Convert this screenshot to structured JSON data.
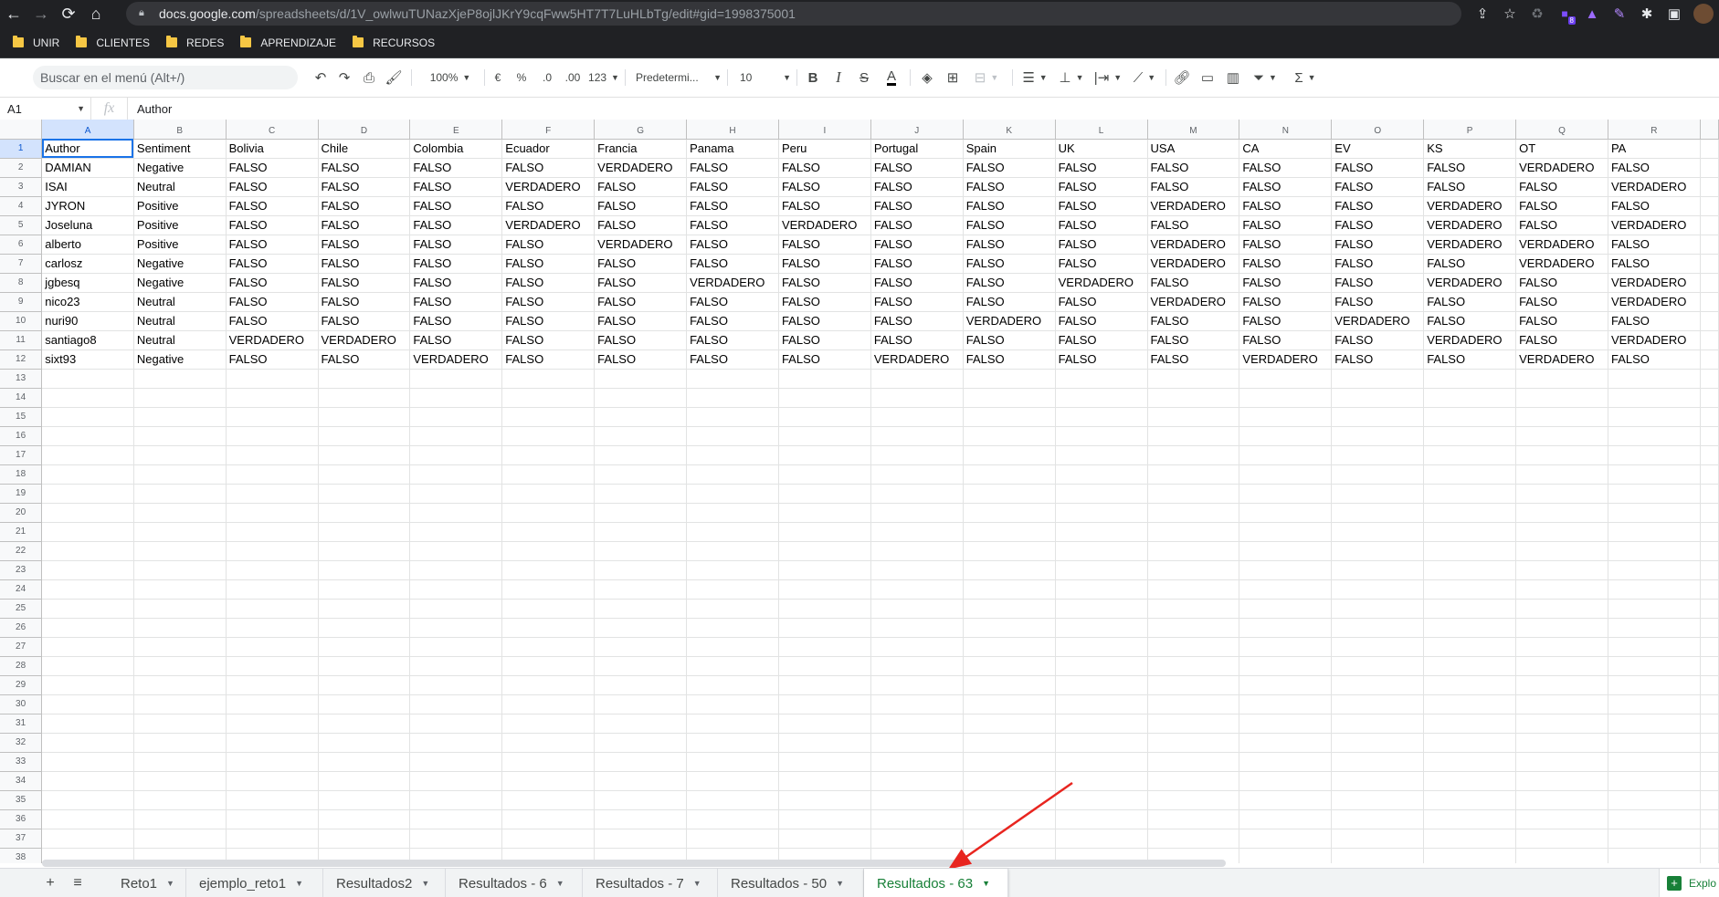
{
  "browser": {
    "url_host": "docs.google.com",
    "url_path": "/spreadsheets/d/1V_owlwuTUNazXjeP8ojlJKrY9cqFww5HT7T7LuHLbTg/edit#gid=1998375001",
    "bookmarks": [
      "UNIR",
      "CLIENTES",
      "REDES",
      "APRENDIZAJE",
      "RECURSOS"
    ],
    "extension_badge": "8"
  },
  "toolbar": {
    "menu_search_placeholder": "Buscar en el menú (Alt+/)",
    "zoom": "100%",
    "currency": "€",
    "percent": "%",
    "decimal_decrease": ".0",
    "decimal_increase": ".00",
    "more_formats": "123",
    "font_family": "Predetermi...",
    "font_size": "10",
    "bold": "B",
    "italic": "I",
    "strike": "S",
    "text_color": "A",
    "functions": "Σ"
  },
  "formula_bar": {
    "name_box": "A1",
    "fx": "fx",
    "content": "Author"
  },
  "grid": {
    "columns": [
      "A",
      "B",
      "C",
      "D",
      "E",
      "F",
      "G",
      "H",
      "I",
      "J",
      "K",
      "L",
      "M",
      "N",
      "O",
      "P",
      "Q",
      "R"
    ],
    "row_numbers": [
      "1",
      "2",
      "3",
      "4",
      "5",
      "6",
      "7",
      "8",
      "9",
      "10",
      "11",
      "12",
      "13",
      "14",
      "15",
      "16",
      "17",
      "18",
      "19",
      "20",
      "21",
      "22",
      "23",
      "24",
      "25",
      "26",
      "27",
      "28",
      "29",
      "30",
      "31",
      "32",
      "33",
      "34",
      "35",
      "36",
      "37",
      "38"
    ],
    "rows": [
      [
        "Author",
        "Sentiment",
        "Bolivia",
        "Chile",
        "Colombia",
        "Ecuador",
        "Francia",
        "Panama",
        "Peru",
        "Portugal",
        "Spain",
        "UK",
        "USA",
        "CA",
        "EV",
        "KS",
        "OT",
        "PA"
      ],
      [
        "DAMIAN",
        "Negative",
        "FALSO",
        "FALSO",
        "FALSO",
        "FALSO",
        "VERDADERO",
        "FALSO",
        "FALSO",
        "FALSO",
        "FALSO",
        "FALSO",
        "FALSO",
        "FALSO",
        "FALSO",
        "FALSO",
        "VERDADERO",
        "FALSO"
      ],
      [
        "ISAI",
        "Neutral",
        "FALSO",
        "FALSO",
        "FALSO",
        "VERDADERO",
        "FALSO",
        "FALSO",
        "FALSO",
        "FALSO",
        "FALSO",
        "FALSO",
        "FALSO",
        "FALSO",
        "FALSO",
        "FALSO",
        "FALSO",
        "VERDADERO"
      ],
      [
        "JYRON",
        "Positive",
        "FALSO",
        "FALSO",
        "FALSO",
        "FALSO",
        "FALSO",
        "FALSO",
        "FALSO",
        "FALSO",
        "FALSO",
        "FALSO",
        "VERDADERO",
        "FALSO",
        "FALSO",
        "VERDADERO",
        "FALSO",
        "FALSO"
      ],
      [
        "Joseluna",
        "Positive",
        "FALSO",
        "FALSO",
        "FALSO",
        "VERDADERO",
        "FALSO",
        "FALSO",
        "VERDADERO",
        "FALSO",
        "FALSO",
        "FALSO",
        "FALSO",
        "FALSO",
        "FALSO",
        "VERDADERO",
        "FALSO",
        "VERDADERO"
      ],
      [
        "alberto",
        "Positive",
        "FALSO",
        "FALSO",
        "FALSO",
        "FALSO",
        "VERDADERO",
        "FALSO",
        "FALSO",
        "FALSO",
        "FALSO",
        "FALSO",
        "VERDADERO",
        "FALSO",
        "FALSO",
        "VERDADERO",
        "VERDADERO",
        "FALSO"
      ],
      [
        "carlosz",
        "Negative",
        "FALSO",
        "FALSO",
        "FALSO",
        "FALSO",
        "FALSO",
        "FALSO",
        "FALSO",
        "FALSO",
        "FALSO",
        "FALSO",
        "VERDADERO",
        "FALSO",
        "FALSO",
        "FALSO",
        "VERDADERO",
        "FALSO"
      ],
      [
        "jgbesq",
        "Negative",
        "FALSO",
        "FALSO",
        "FALSO",
        "FALSO",
        "FALSO",
        "VERDADERO",
        "FALSO",
        "FALSO",
        "FALSO",
        "VERDADERO",
        "FALSO",
        "FALSO",
        "FALSO",
        "VERDADERO",
        "FALSO",
        "VERDADERO"
      ],
      [
        "nico23",
        "Neutral",
        "FALSO",
        "FALSO",
        "FALSO",
        "FALSO",
        "FALSO",
        "FALSO",
        "FALSO",
        "FALSO",
        "FALSO",
        "FALSO",
        "VERDADERO",
        "FALSO",
        "FALSO",
        "FALSO",
        "FALSO",
        "VERDADERO"
      ],
      [
        "nuri90",
        "Neutral",
        "FALSO",
        "FALSO",
        "FALSO",
        "FALSO",
        "FALSO",
        "FALSO",
        "FALSO",
        "FALSO",
        "VERDADERO",
        "FALSO",
        "FALSO",
        "FALSO",
        "VERDADERO",
        "FALSO",
        "FALSO",
        "FALSO"
      ],
      [
        "santiago8",
        "Neutral",
        "VERDADERO",
        "VERDADERO",
        "FALSO",
        "FALSO",
        "FALSO",
        "FALSO",
        "FALSO",
        "FALSO",
        "FALSO",
        "FALSO",
        "FALSO",
        "FALSO",
        "FALSO",
        "VERDADERO",
        "FALSO",
        "VERDADERO"
      ],
      [
        "sixt93",
        "Negative",
        "FALSO",
        "FALSO",
        "VERDADERO",
        "FALSO",
        "FALSO",
        "FALSO",
        "FALSO",
        "VERDADERO",
        "FALSO",
        "FALSO",
        "FALSO",
        "VERDADERO",
        "FALSO",
        "FALSO",
        "VERDADERO",
        "FALSO"
      ]
    ]
  },
  "sheet_tabs": {
    "add": "+",
    "list": "≡",
    "tabs": [
      "Reto1",
      "ejemplo_reto1",
      "Resultados2",
      "Resultados - 6",
      "Resultados - 7",
      "Resultados - 50",
      "Resultados - 63"
    ],
    "active_index": 6,
    "explore_label": "Explo"
  },
  "colors": {
    "active_tab": "#188038",
    "selection": "#1a73e8",
    "annotation_arrow": "#e8251f"
  }
}
